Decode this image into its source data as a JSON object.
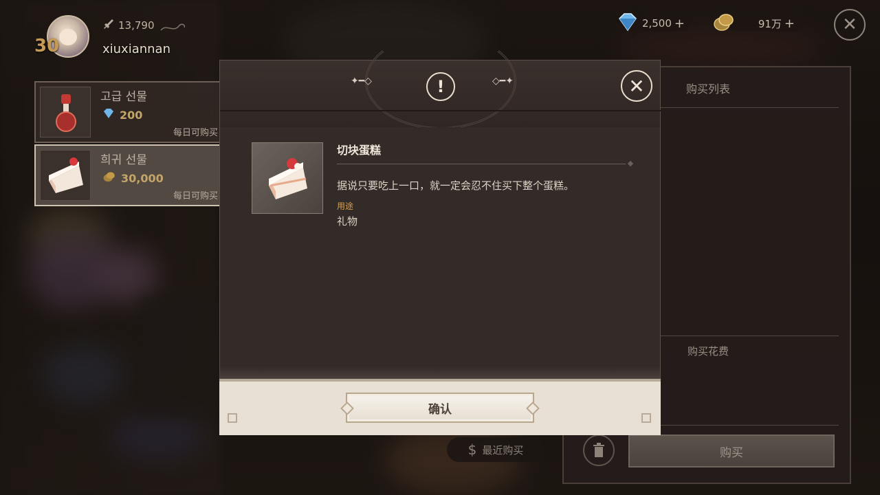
{
  "player": {
    "level": "30",
    "power": "13,790",
    "username": "xiuxiannan"
  },
  "currencies": [
    {
      "name": "diamond",
      "icon": "diamond-icon",
      "value": "2,500"
    },
    {
      "name": "gold",
      "icon": "gold-coin-icon",
      "value": "91万"
    }
  ],
  "shop_items": [
    {
      "name": "고급 선물",
      "price_icon": "diamond-icon",
      "price": "200",
      "limit": "每日可购买"
    },
    {
      "name": "희귀 선물",
      "price_icon": "gold-coin-icon",
      "price": "30,000",
      "limit": "每日可购买"
    }
  ],
  "cart": {
    "title": "购买列表",
    "cost_label": "购买花费",
    "buy_label": "购买",
    "recent_label": "最近购买"
  },
  "modal": {
    "item_name": "切块蛋糕",
    "description": "据说只要吃上一口，就一定会忍不住买下整个蛋糕。",
    "use_label": "用途",
    "use_value": "礼物",
    "confirm_label": "确认"
  },
  "colors": {
    "accent_gold": "#c59a55",
    "modal_body": "#322b28",
    "footer_bg": "#e8e0d4"
  }
}
